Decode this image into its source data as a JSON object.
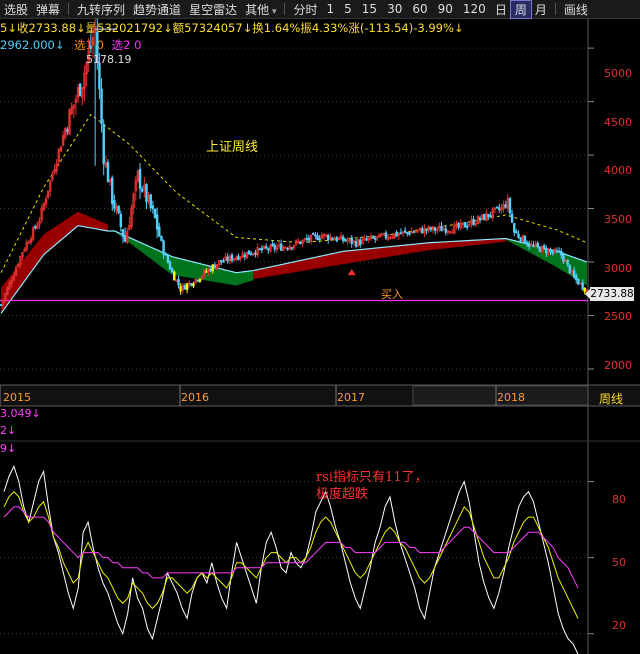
{
  "toolbar": {
    "items": [
      "选股",
      "弹幕",
      "九转序列",
      "趋势通道",
      "星空雷达",
      "其他"
    ],
    "periods": [
      "分时",
      "1",
      "5",
      "15",
      "30",
      "60",
      "90",
      "120",
      "日",
      "周",
      "月"
    ],
    "active_period": "周",
    "extra": "画线"
  },
  "info": {
    "ohlc": "5↓收2733.88↓量532021792↓额57324057↓换1.64%振4.33%涨(-113.54)-3.99%↓",
    "line2_value": "2962.000↓",
    "line2_sel1": "选1 0",
    "line2_sel2": "选2 0"
  },
  "annotations": {
    "chart_name": "上证周线",
    "peak_label": "5178.19",
    "buy_label": "买入",
    "rsi_note_line1": "rsi指标只有11了，",
    "rsi_note_line2": "极度超跌",
    "current_price": "2733.88",
    "period_label": "周线"
  },
  "rsi_header": {
    "line1": "3.049↓",
    "line2": "2↓",
    "line3": "9↓"
  },
  "colors": {
    "bg": "#000000",
    "up": "#e03030",
    "down": "#54d0ff",
    "yellow_candle": "#ffff00",
    "red_band": "#a00000",
    "green_band": "#007a1e",
    "ma_dash": "#e8e000",
    "support_line": "#ff30ff",
    "price_axis_text": "#e03030",
    "rsi_fast": "#ffffff",
    "rsi_mid": "#f0f000",
    "rsi_slow": "#ff40ff"
  },
  "chart_data": [
    {
      "type": "candlestick",
      "title": "上证周线",
      "period": "weekly",
      "y_ticks": [
        2000,
        2500,
        3000,
        3500,
        4000,
        4500,
        5000
      ],
      "ylim": [
        1850,
        5450
      ],
      "x_ticks": [
        "2015",
        "2016",
        "2017",
        "2018"
      ],
      "peak": 5178.19,
      "last_close": 2733.88,
      "support": 2640,
      "buy_signal_level": 2990,
      "trend": [
        [
          0,
          2600
        ],
        [
          10,
          3100
        ],
        [
          18,
          3400
        ],
        [
          30,
          4250
        ],
        [
          38,
          4700
        ],
        [
          44,
          5178
        ],
        [
          48,
          4000
        ],
        [
          52,
          3600
        ],
        [
          58,
          3200
        ],
        [
          64,
          3800
        ],
        [
          72,
          3400
        ],
        [
          76,
          3100
        ],
        [
          80,
          2900
        ],
        [
          84,
          2750
        ],
        [
          92,
          2850
        ],
        [
          102,
          3000
        ],
        [
          118,
          3100
        ],
        [
          134,
          3150
        ],
        [
          150,
          3250
        ],
        [
          166,
          3180
        ],
        [
          182,
          3250
        ],
        [
          198,
          3300
        ],
        [
          214,
          3320
        ],
        [
          226,
          3420
        ],
        [
          234,
          3500
        ],
        [
          237,
          3560
        ],
        [
          240,
          3280
        ],
        [
          248,
          3150
        ],
        [
          262,
          3070
        ],
        [
          268,
          2850
        ],
        [
          274,
          2733.88
        ]
      ],
      "ma_dashed": [
        [
          0,
          2900
        ],
        [
          20,
          3700
        ],
        [
          42,
          4380
        ],
        [
          60,
          4100
        ],
        [
          82,
          3650
        ],
        [
          110,
          3230
        ],
        [
          140,
          3180
        ],
        [
          180,
          3250
        ],
        [
          215,
          3360
        ],
        [
          236,
          3440
        ],
        [
          260,
          3300
        ],
        [
          274,
          3180
        ]
      ],
      "band_red": [
        [
          0,
          2520,
          2760
        ],
        [
          20,
          3070,
          3260
        ],
        [
          36,
          3340,
          3470
        ],
        [
          50,
          3290,
          3350
        ]
      ],
      "band_green": [
        [
          52,
          3300,
          3300
        ],
        [
          80,
          3050,
          2880
        ],
        [
          110,
          2900,
          2780
        ],
        [
          118,
          2920,
          2830
        ]
      ],
      "band_red2": [
        [
          118,
          2920,
          2840
        ],
        [
          160,
          3100,
          2980
        ],
        [
          200,
          3180,
          3110
        ],
        [
          236,
          3220,
          3190
        ]
      ],
      "band_green2": [
        [
          236,
          3220,
          3210
        ],
        [
          260,
          3100,
          2950
        ],
        [
          274,
          3000,
          2780
        ]
      ]
    },
    {
      "type": "line",
      "title": "RSI",
      "y_ticks": [
        20,
        50,
        80
      ],
      "ylim": [
        12,
        96
      ],
      "series": [
        {
          "values": [
            76,
            82,
            86,
            80,
            70,
            64,
            72,
            80,
            84,
            70,
            58,
            52,
            44,
            36,
            30,
            38,
            60,
            64,
            54,
            46,
            40,
            36,
            30,
            24,
            20,
            28,
            42,
            34,
            30,
            22,
            18,
            26,
            34,
            44,
            40,
            36,
            30,
            26,
            36,
            42,
            44,
            40,
            48,
            40,
            34,
            30,
            44,
            56,
            50,
            44,
            38,
            32,
            46,
            56,
            60,
            54,
            46,
            44,
            52,
            48,
            46,
            50,
            58,
            68,
            72,
            76,
            70,
            62,
            56,
            48,
            40,
            34,
            30,
            38,
            46,
            56,
            62,
            70,
            74,
            64,
            56,
            50,
            44,
            38,
            30,
            26,
            36,
            46,
            52,
            58,
            64,
            70,
            76,
            80,
            72,
            60,
            48,
            40,
            34,
            30,
            36,
            44,
            54,
            62,
            70,
            74,
            76,
            72,
            64,
            56,
            48,
            38,
            28,
            22,
            18,
            16,
            12
          ]
        },
        {
          "values": [
            70,
            74,
            76,
            74,
            68,
            64,
            66,
            70,
            72,
            66,
            58,
            54,
            48,
            44,
            40,
            42,
            52,
            56,
            52,
            48,
            44,
            42,
            38,
            34,
            32,
            34,
            40,
            38,
            36,
            32,
            30,
            32,
            36,
            42,
            42,
            40,
            38,
            36,
            38,
            42,
            44,
            42,
            44,
            42,
            40,
            38,
            42,
            48,
            48,
            46,
            44,
            42,
            46,
            50,
            52,
            52,
            50,
            48,
            50,
            50,
            48,
            50,
            54,
            60,
            64,
            66,
            64,
            60,
            56,
            52,
            48,
            44,
            42,
            44,
            48,
            52,
            56,
            60,
            62,
            60,
            56,
            54,
            50,
            46,
            42,
            40,
            42,
            46,
            50,
            54,
            58,
            62,
            66,
            70,
            68,
            62,
            56,
            50,
            46,
            42,
            42,
            46,
            50,
            56,
            60,
            64,
            66,
            66,
            62,
            58,
            54,
            48,
            42,
            38,
            34,
            30,
            26
          ]
        },
        {
          "values": [
            66,
            68,
            70,
            70,
            68,
            66,
            66,
            66,
            66,
            64,
            60,
            58,
            56,
            54,
            52,
            50,
            52,
            52,
            52,
            52,
            50,
            50,
            48,
            48,
            46,
            46,
            46,
            46,
            44,
            44,
            42,
            42,
            42,
            44,
            44,
            44,
            44,
            44,
            44,
            44,
            44,
            44,
            44,
            44,
            44,
            44,
            44,
            46,
            46,
            46,
            46,
            46,
            46,
            48,
            48,
            48,
            48,
            48,
            48,
            48,
            48,
            48,
            50,
            52,
            54,
            56,
            56,
            56,
            56,
            54,
            54,
            52,
            52,
            52,
            52,
            52,
            54,
            56,
            56,
            56,
            56,
            56,
            54,
            54,
            52,
            52,
            52,
            52,
            52,
            54,
            56,
            58,
            60,
            62,
            62,
            60,
            58,
            56,
            54,
            52,
            52,
            52,
            52,
            54,
            56,
            58,
            60,
            60,
            60,
            58,
            56,
            54,
            50,
            48,
            46,
            42,
            38
          ]
        }
      ]
    }
  ]
}
